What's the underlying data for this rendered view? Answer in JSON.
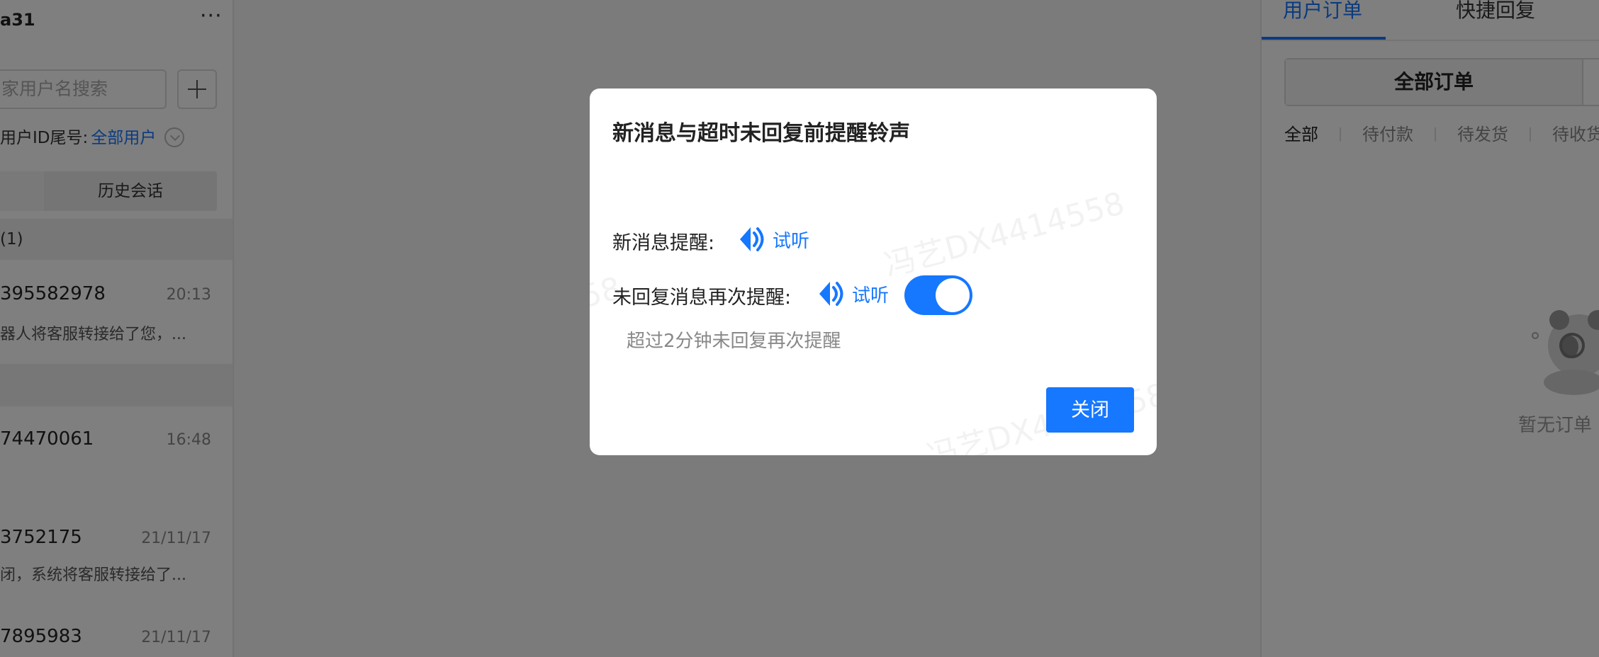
{
  "left": {
    "title": "a31",
    "more": "···",
    "search_placeholder": "家用户名搜索",
    "filter_label": "用户ID尾号:",
    "filter_value": "全部用户",
    "history_tab": "历史会话",
    "group1": "(1)",
    "conversations": [
      {
        "name": "395582978",
        "time": "20:13",
        "snippet": "器人将客服转接给了您，..."
      },
      {
        "name": "74470061",
        "time": "16:48",
        "snippet": ""
      },
      {
        "name": "3752175",
        "time": "21/11/17",
        "snippet": "闭，系统将客服转接给了..."
      },
      {
        "name": "7895983",
        "time": "21/11/17",
        "snippet": ""
      }
    ]
  },
  "right": {
    "tabs": [
      "用户订单",
      "快捷回复"
    ],
    "segment_active": "全部订单",
    "status_tabs": [
      "全部",
      "待付款",
      "待发货",
      "待收货"
    ],
    "empty_text": "暂无订单"
  },
  "modal": {
    "title": "新消息与超时未回复前提醒铃声",
    "new_msg_label": "新消息提醒:",
    "listen_label": "试听",
    "repeat_label": "未回复消息再次提醒:",
    "hint": "超过2分钟未回复再次提醒",
    "close_label": "关闭",
    "watermark": "冯艺DX4414558",
    "toggle_on": true
  },
  "colors": {
    "accent": "#1677ff",
    "mask": "rgba(0,0,0,0.5)"
  }
}
